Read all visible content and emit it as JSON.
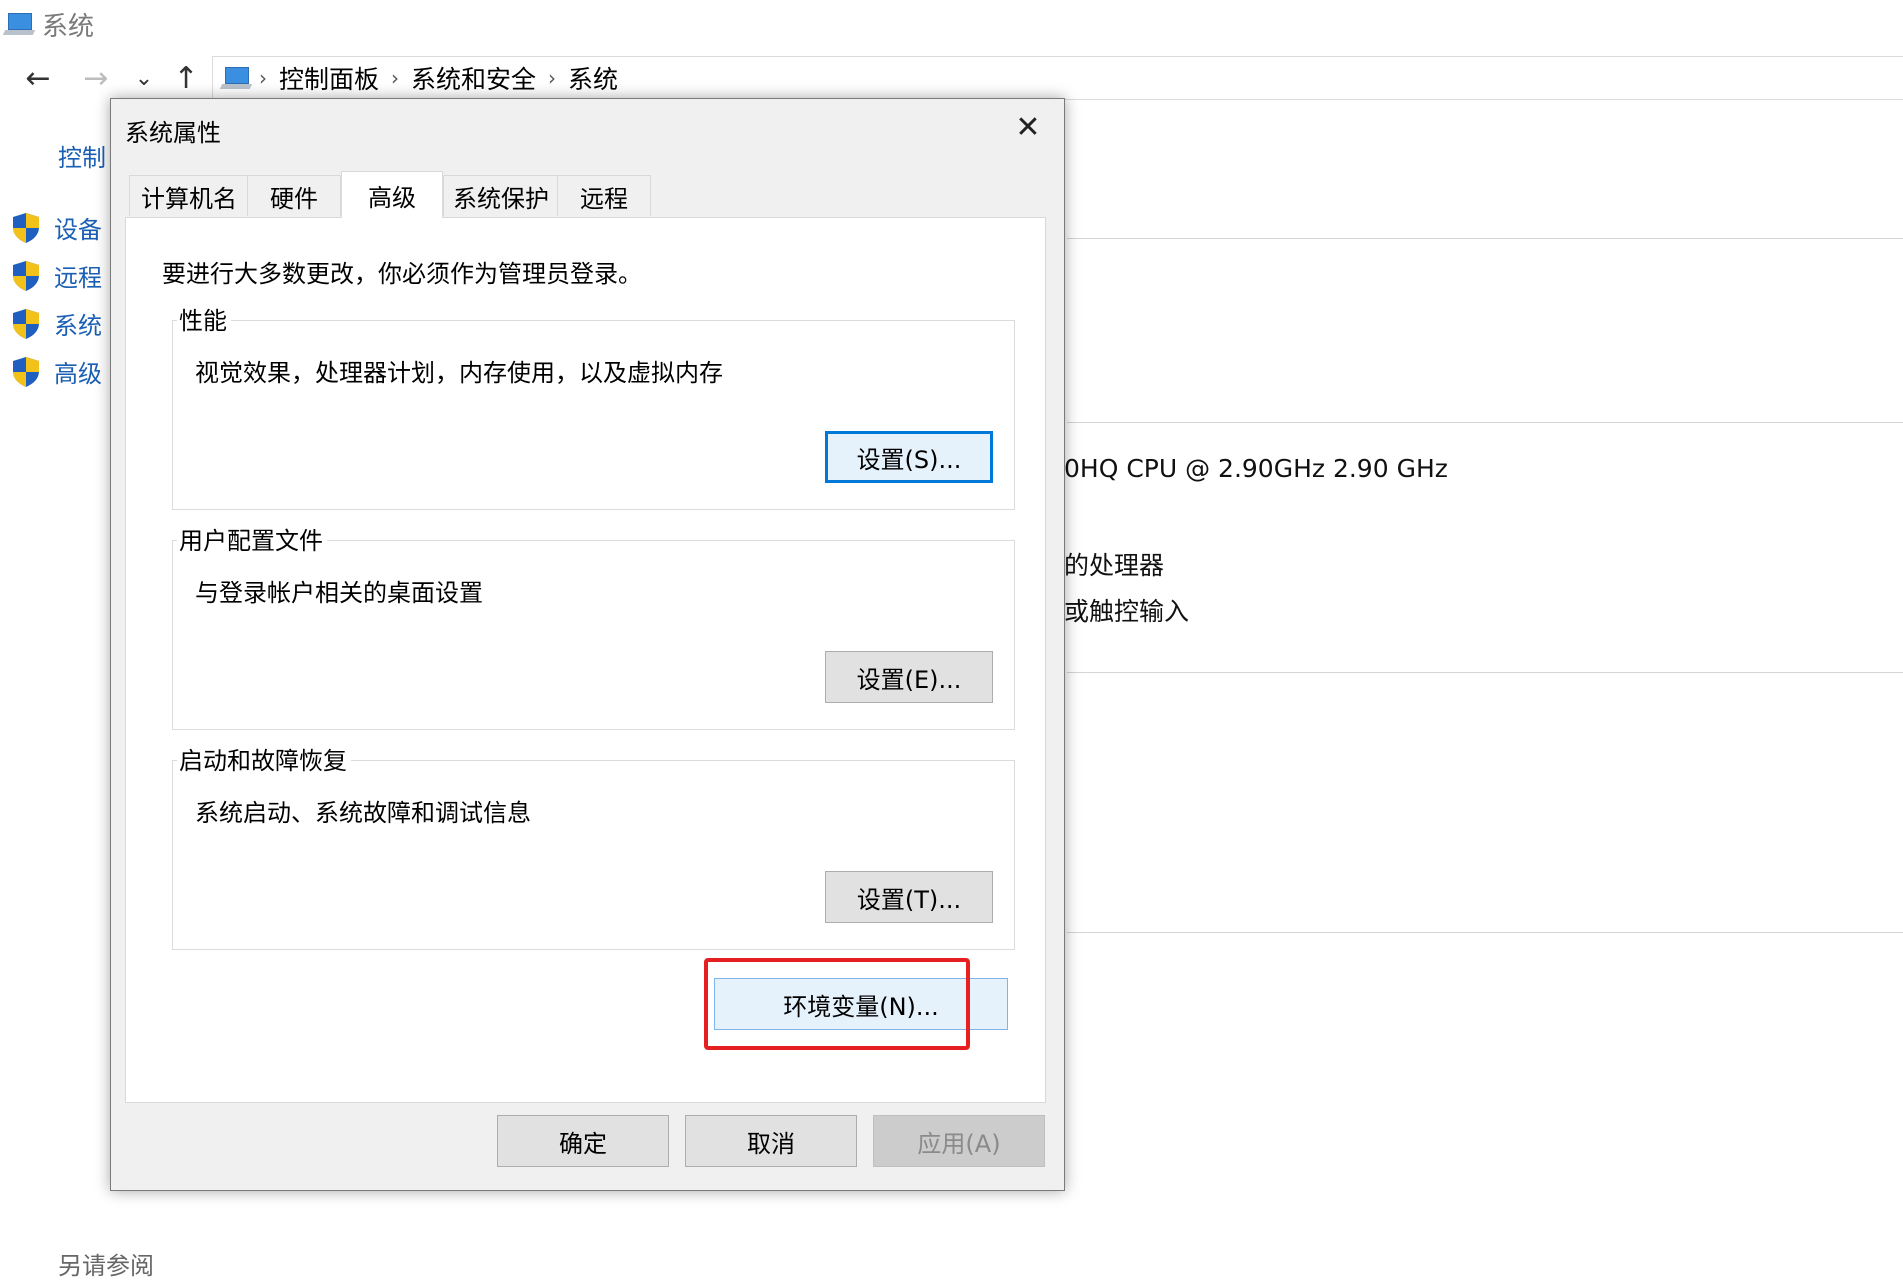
{
  "window": {
    "title": "系统",
    "icon": "computer-icon"
  },
  "nav": {
    "back_icon": "←",
    "forward_icon": "→",
    "recent_icon": "⌄",
    "up_icon": "↑",
    "breadcrumb": [
      "控制面板",
      "系统和安全",
      "系统"
    ],
    "separator": "›"
  },
  "left_pane": {
    "home_partial": "控制",
    "items": [
      {
        "label": "设备",
        "icon": "uac-shield-icon"
      },
      {
        "label": "远程",
        "icon": "uac-shield-icon"
      },
      {
        "label": "系统",
        "icon": "uac-shield-icon"
      },
      {
        "label": "高级",
        "icon": "uac-shield-icon"
      }
    ],
    "bottom_partial": "另请参阅"
  },
  "background_info": {
    "cpu_partial": "0HQ CPU @ 2.90GHz   2.90 GHz",
    "processor_partial": "的处理器",
    "touch_partial": "或触控输入"
  },
  "dialog": {
    "title": "系统属性",
    "close_icon": "✕",
    "tabs": [
      {
        "label": "计算机名",
        "active": false
      },
      {
        "label": "硬件",
        "active": false
      },
      {
        "label": "高级",
        "active": true
      },
      {
        "label": "系统保护",
        "active": false
      },
      {
        "label": "远程",
        "active": false
      }
    ],
    "admin_notice": "要进行大多数更改，你必须作为管理员登录。",
    "groups": [
      {
        "label": "性能",
        "description": "视觉效果，处理器计划，内存使用，以及虚拟内存",
        "button": "设置(S)..."
      },
      {
        "label": "用户配置文件",
        "description": "与登录帐户相关的桌面设置",
        "button": "设置(E)..."
      },
      {
        "label": "启动和故障恢复",
        "description": "系统启动、系统故障和调试信息",
        "button": "设置(T)..."
      }
    ],
    "env_button": "环境变量(N)...",
    "ok": "确定",
    "cancel": "取消",
    "apply": "应用(A)"
  },
  "colors": {
    "link": "#1a5fb4",
    "focus": "#0078d7",
    "highlight": "#e62020"
  }
}
